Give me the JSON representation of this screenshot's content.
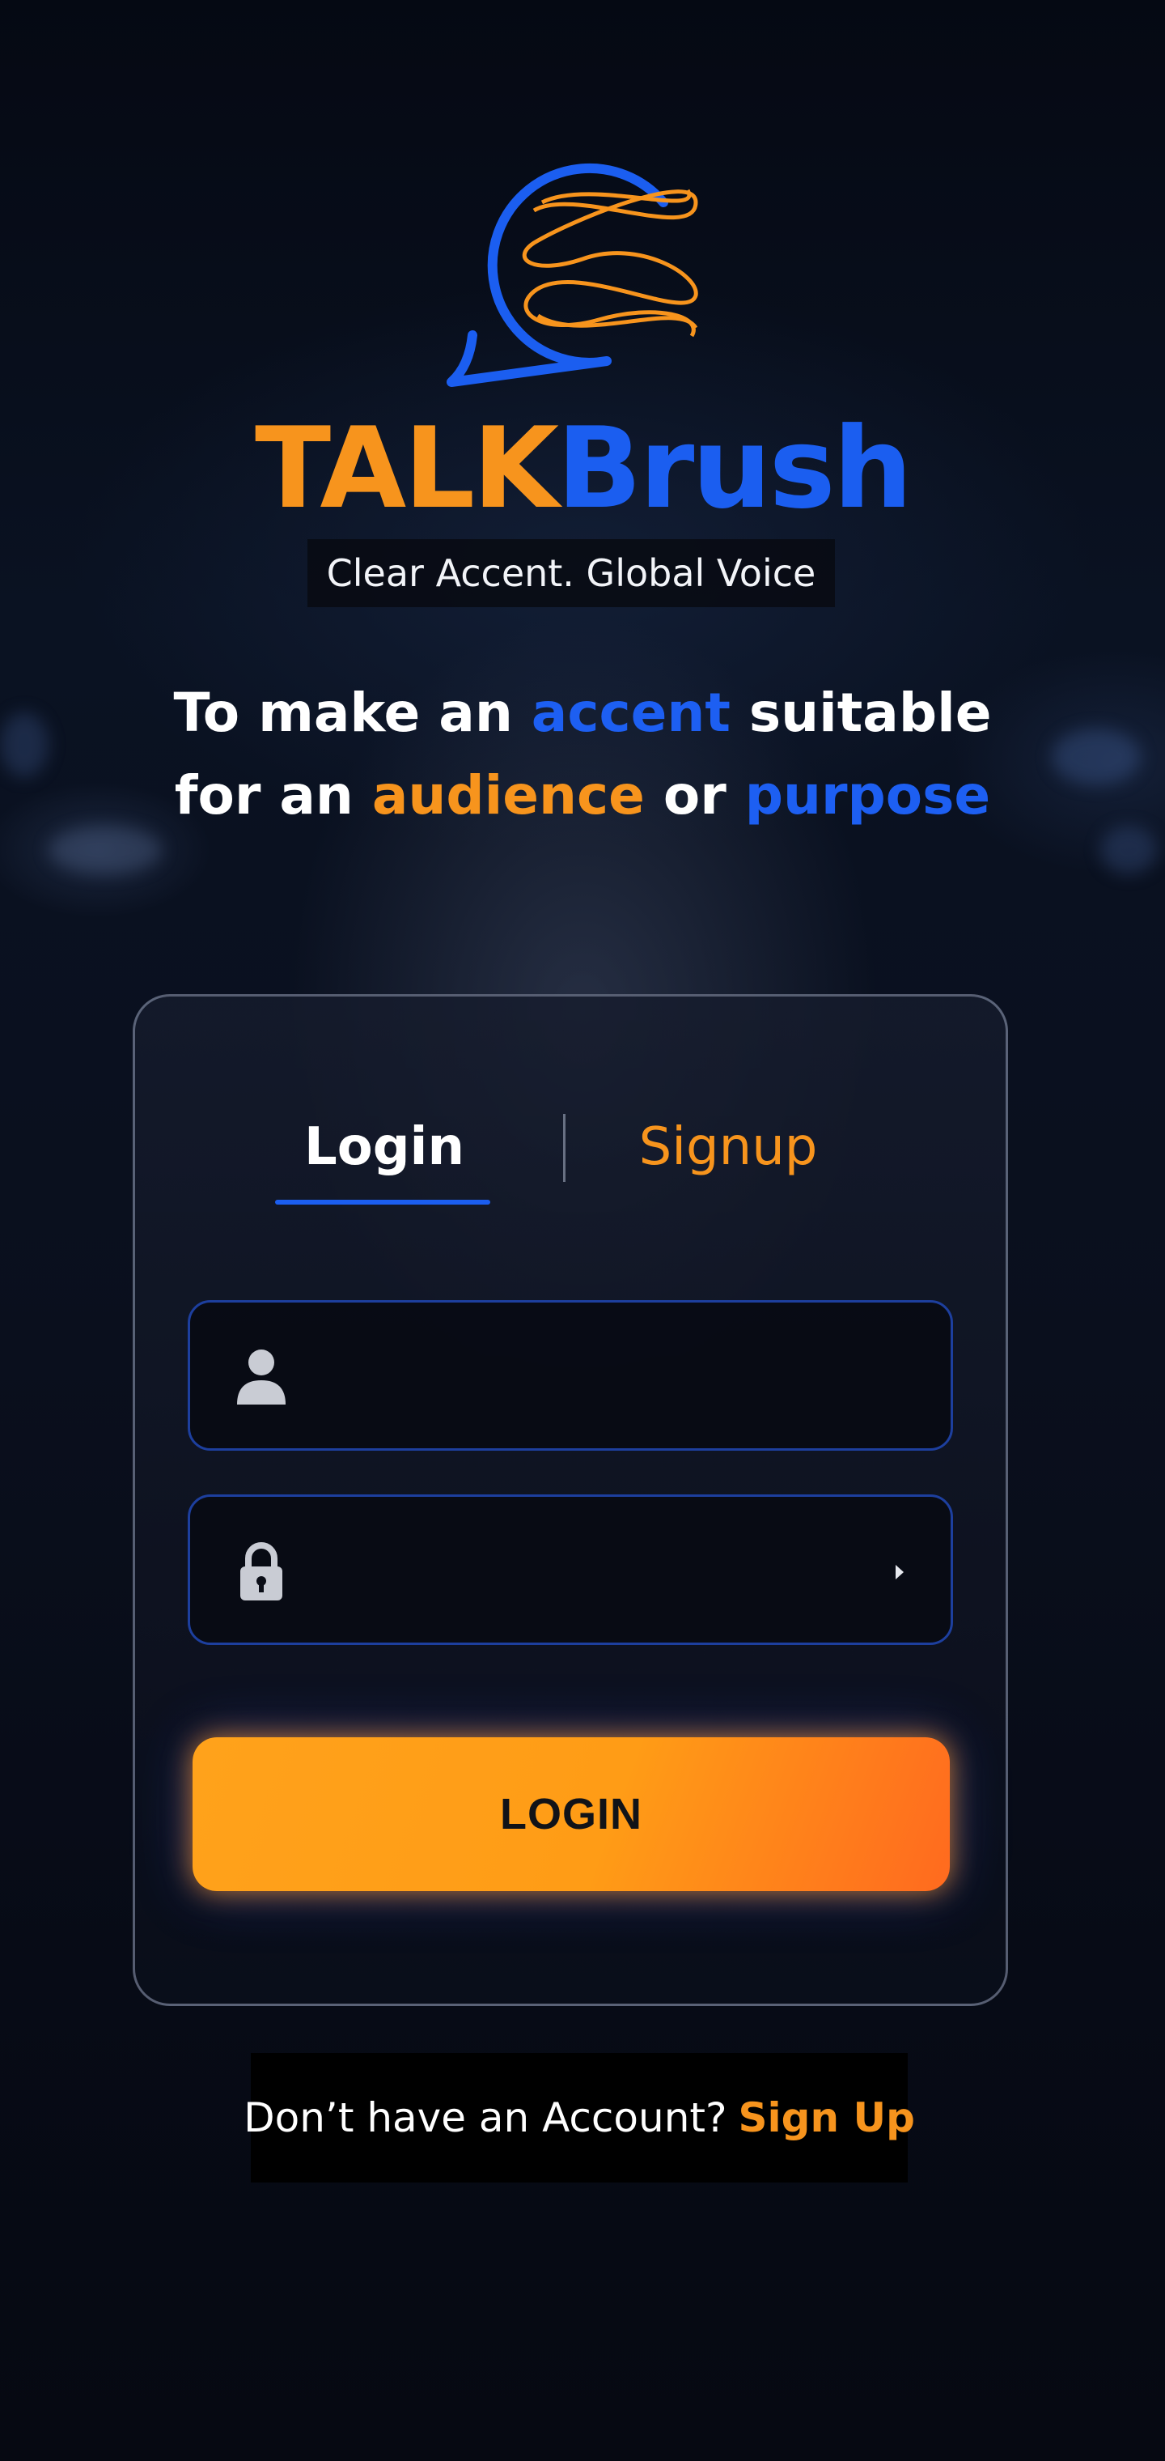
{
  "brand": {
    "name_part1": "TALK",
    "name_part2": "Brush",
    "tagline": "Clear Accent. Global Voice",
    "logo_icon": "speech-bubble-waves-logo",
    "colors": {
      "orange": "#f7941d",
      "blue": "#1b5ef0"
    }
  },
  "headline": {
    "w1": "To make an ",
    "w2": "accent",
    "w3": " suitable",
    "w4": "for an ",
    "w5": "audience",
    "w6": " or ",
    "w7": "purpose"
  },
  "auth_tabs": {
    "login_label": "Login",
    "signup_label": "Signup",
    "active": "Login"
  },
  "form": {
    "username": {
      "value": "",
      "placeholder": "",
      "icon": "user-icon"
    },
    "password": {
      "value": "",
      "placeholder": "",
      "icon": "lock-icon",
      "toggle_icon": "reveal-arrow-icon"
    },
    "submit_label": "LOGIN"
  },
  "footer": {
    "prompt": "Don’t have an Account?",
    "link_label": "Sign Up"
  }
}
